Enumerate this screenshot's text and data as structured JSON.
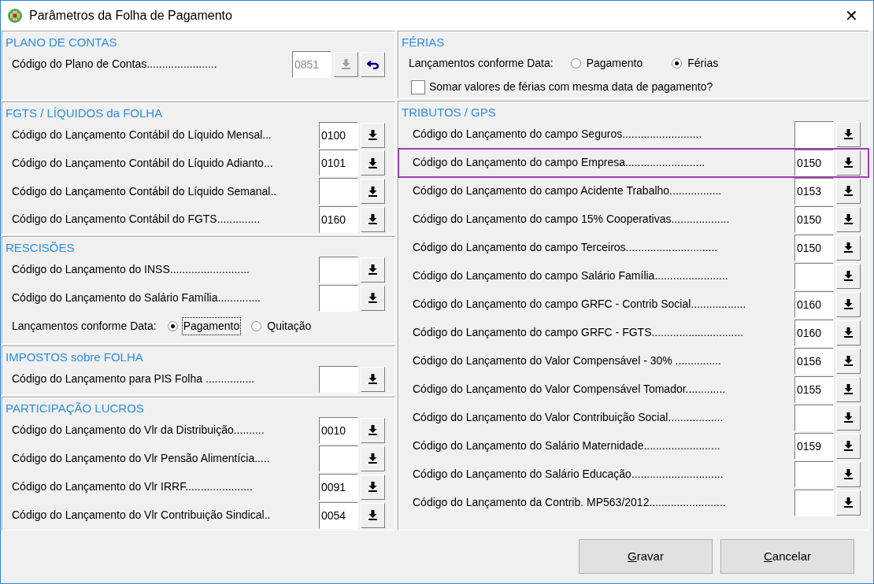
{
  "window": {
    "title": "Parâmetros da Folha de Pagamento",
    "close": "✕"
  },
  "left_sections": [
    {
      "title": "PLANO DE CONTAS",
      "rows": [
        {
          "kind": "code",
          "label": "Código do Plano de Contas.......................",
          "value": "0851",
          "disabled": true,
          "undo": true
        }
      ]
    },
    {
      "title": "FGTS / LÍQUIDOS da FOLHA",
      "rows": [
        {
          "kind": "code",
          "label": "Código do Lançamento Contábil do Líquido Mensal...",
          "value": "0100"
        },
        {
          "kind": "code",
          "label": "Código do Lançamento Contábil do Líquido Adianto...",
          "value": "0101"
        },
        {
          "kind": "code",
          "label": "Código do Lançamento Contábil do Líquido Semanal..",
          "value": ""
        },
        {
          "kind": "code",
          "label": "Código do Lançamento Contábil do FGTS..............",
          "value": "0160"
        }
      ]
    },
    {
      "title": "RESCISÕES",
      "rows": [
        {
          "kind": "code",
          "label": "Código do Lançamento do INSS..........................",
          "value": ""
        },
        {
          "kind": "code",
          "label": "Código do Lançamento do Salário Família..............",
          "value": ""
        },
        {
          "kind": "radio",
          "label": "Lançamentos conforme Data:",
          "options": [
            {
              "label": "Pagamento",
              "selected": true,
              "focused": true
            },
            {
              "label": "Quitação",
              "selected": false,
              "focused": false
            }
          ]
        }
      ]
    },
    {
      "title": "IMPOSTOS sobre FOLHA",
      "rows": [
        {
          "kind": "code",
          "label": "Código do Lançamento para PIS Folha ................",
          "value": ""
        }
      ]
    },
    {
      "title": "PARTICIPAÇÃO  LUCROS",
      "rows": [
        {
          "kind": "code",
          "label": "Código do Lançamento do Vlr da Distribuição..........",
          "value": "0010"
        },
        {
          "kind": "code",
          "label": "Código do Lançamento do Vlr Pensão Alimentícia.....",
          "value": ""
        },
        {
          "kind": "code",
          "label": "Código do Lançamento do Vlr IRRF......................",
          "value": "0091"
        },
        {
          "kind": "code",
          "label": "Código do Lançamento do Vlr Contribuição Sindical..",
          "value": "0054"
        }
      ]
    }
  ],
  "right_sections": [
    {
      "title": "FÉRIAS",
      "rows": [
        {
          "kind": "radio",
          "label": "Lançamentos conforme Data:",
          "options": [
            {
              "label": "Pagamento",
              "selected": false,
              "focused": false
            },
            {
              "label": "Férias",
              "selected": true,
              "focused": false
            }
          ]
        },
        {
          "kind": "checkbox",
          "label": "Somar valores de férias com mesma data de pagamento?",
          "checked": false
        }
      ]
    },
    {
      "title": "TRIBUTOS  /  GPS",
      "rows": [
        {
          "kind": "code",
          "label": "Código do Lançamento do campo Seguros..........................",
          "value": "",
          "highlighted": false
        },
        {
          "kind": "code",
          "label": "Código do Lançamento do campo Empresa..........................",
          "value": "0150",
          "highlighted": true
        },
        {
          "kind": "code",
          "label": "Código do Lançamento do campo Acidente Trabalho.................",
          "value": "0153",
          "highlighted": false
        },
        {
          "kind": "code",
          "label": "Código do Lançamento do campo 15% Cooperativas...................",
          "value": "0150",
          "highlighted": false
        },
        {
          "kind": "code",
          "label": "Código do Lançamento do campo Terceiros..............................",
          "value": "0150",
          "highlighted": false
        },
        {
          "kind": "code",
          "label": "Código do Lançamento do campo Salário Família........................",
          "value": "",
          "highlighted": false
        },
        {
          "kind": "code",
          "label": "Código do Lançamento do campo GRFC - Contrib Social..................",
          "value": "0160",
          "highlighted": false
        },
        {
          "kind": "code",
          "label": "Código do Lançamento do campo GRFC - FGTS..............................",
          "value": "0160",
          "highlighted": false
        },
        {
          "kind": "code",
          "label": "Código do Lançamento do Valor Compensável - 30% ...............",
          "value": "0156",
          "highlighted": false
        },
        {
          "kind": "code",
          "label": "Código do Lançamento do Valor Compensável Tomador.............",
          "value": "0155",
          "highlighted": false
        },
        {
          "kind": "code",
          "label": "Código do Lançamento do Valor Contribuição Social..................",
          "value": "",
          "highlighted": false
        },
        {
          "kind": "code",
          "label": "Código do Lançamento do Salário Maternidade.........................",
          "value": "0159",
          "highlighted": false
        },
        {
          "kind": "code",
          "label": "Código do Lançamento do Salário Educação..............................",
          "value": "",
          "highlighted": false
        },
        {
          "kind": "code",
          "label": "Código do Lançamento da Contrib. MP563/2012.........................",
          "value": "",
          "highlighted": false
        }
      ]
    }
  ],
  "buttons": [
    {
      "label": "Gravar"
    },
    {
      "label": "Cancelar"
    }
  ]
}
